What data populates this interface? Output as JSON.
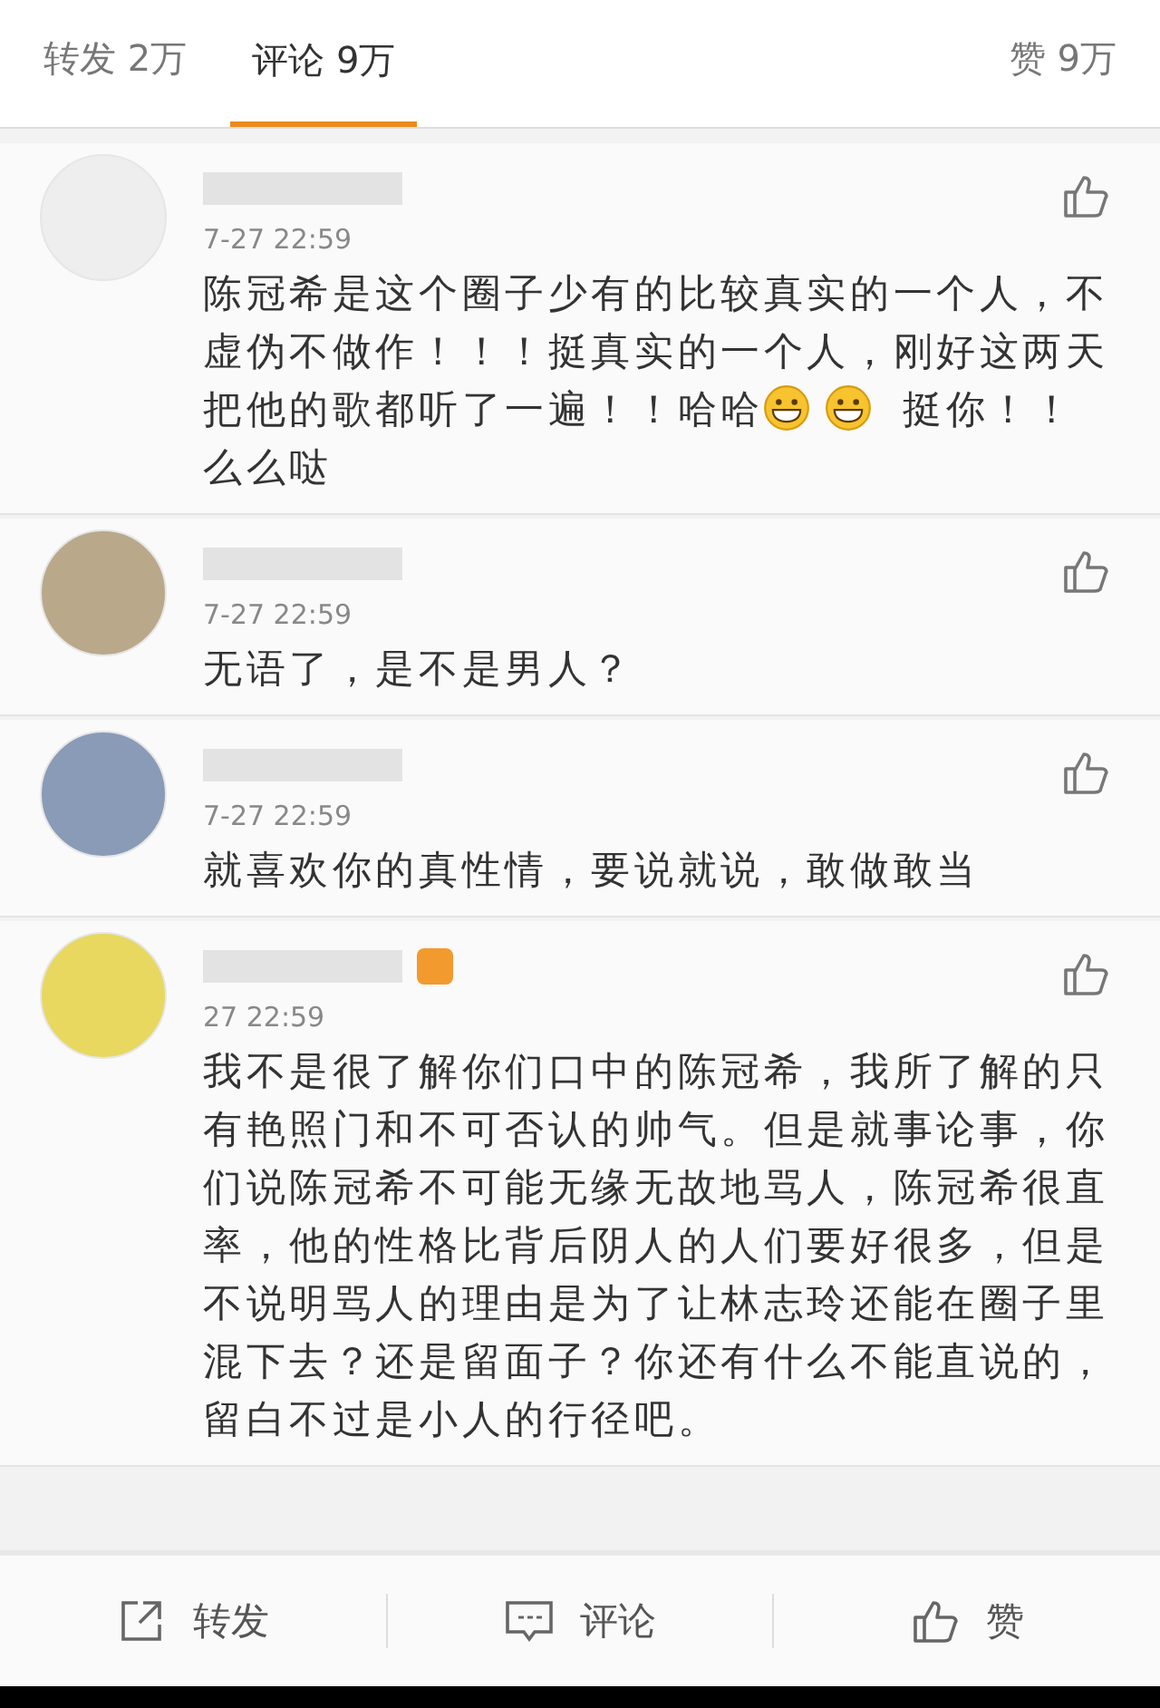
{
  "tabs": [
    {
      "label": "转发 2万",
      "selected": false
    },
    {
      "label": "评论 9万",
      "selected": true
    }
  ],
  "likes_tab": {
    "label": "赞 9万"
  },
  "comments": [
    {
      "time": "7-27 22:59",
      "body": [
        {
          "kind": "text",
          "text": "陈冠希是这个圈子少有的比较真实的一个人，不虚伪不做作！！！挺真实的一个人，刚好这两天把他的歌都听了一遍！！哈哈"
        },
        {
          "kind": "emoji"
        },
        {
          "kind": "emoji"
        },
        {
          "kind": "text",
          "text": " 挺你！！么么哒"
        }
      ]
    },
    {
      "time": "7-27 22:59",
      "body": [
        {
          "kind": "text",
          "text": "无语了，是不是男人？"
        }
      ]
    },
    {
      "time": "7-27 22:59",
      "body": [
        {
          "kind": "text",
          "text": "就喜欢你的真性情，要说就说，敢做敢当"
        }
      ]
    },
    {
      "time": "27 22:59",
      "badge": true,
      "body": [
        {
          "kind": "text",
          "text": "我不是很了解你们口中的陈冠希，我所了解的只有艳照门和不可否认的帅气。但是就事论事，你们说陈冠希不可能无缘无故地骂人，陈冠希很直率，他的性格比背后阴人的人们要好很多，但是不说明骂人的理由是为了让林志玲还能在圈子里混下去？还是留面子？你还有什么不能直说的，留白不过是小人的行径吧。"
        }
      ]
    }
  ],
  "actions": [
    {
      "kind": "share",
      "label": "转发"
    },
    {
      "kind": "comment",
      "label": "评论"
    },
    {
      "kind": "like",
      "label": "赞"
    }
  ]
}
